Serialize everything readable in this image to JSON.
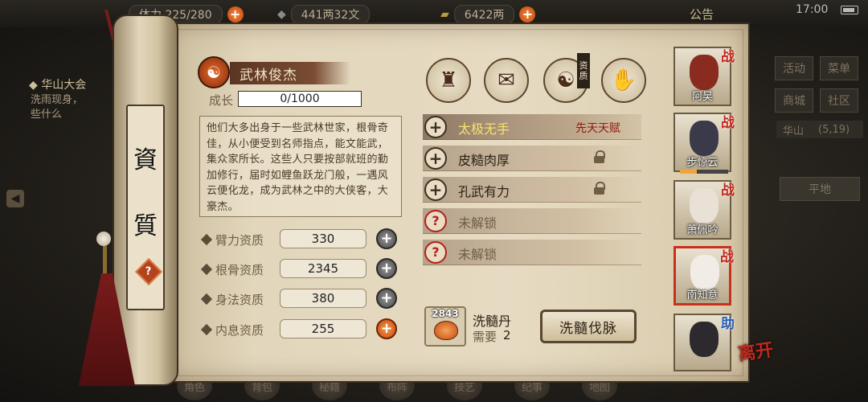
{
  "topbar": {
    "stamina": "体力 225/280",
    "coins": "441两32文",
    "ingots": "6422两",
    "notice": "公告",
    "time": "17:00"
  },
  "background": {
    "left_title": "华山大会",
    "left_desc": "洗雨现身，\n些什么",
    "right_menu": [
      "活动",
      "菜单",
      "商城",
      "社区"
    ],
    "location": "华山",
    "location_coords": "(5,19)",
    "plain_button": "平地",
    "bottom_nav": [
      "角色",
      "背包",
      "秘籍",
      "布阵",
      "技艺",
      "纪事",
      "地图"
    ]
  },
  "scroll": {
    "vertical_title_1": "資",
    "vertical_title_2": "質",
    "help": "?"
  },
  "talent": {
    "name": "武林俊杰",
    "growth_label": "成长",
    "growth_value": "0/1000",
    "description": "他们大多出身于一些武林世家，根骨奇佳，从小便受到名师指点，能文能武，集众家所长。这些人只要按部就班的勤加修行，届时如鲤鱼跃龙门般，一遇风云便化龙，成为武林之中的大侠客，大豪杰。"
  },
  "attributes": [
    {
      "label": "臂力资质",
      "value": "330",
      "plus": "+",
      "plus_color": "gray"
    },
    {
      "label": "根骨资质",
      "value": "2345",
      "plus": "+",
      "plus_color": "gray"
    },
    {
      "label": "身法资质",
      "value": "380",
      "plus": "+",
      "plus_color": "gray"
    },
    {
      "label": "内息资质",
      "value": "255",
      "plus": "+",
      "plus_color": "orange"
    }
  ],
  "skill_icons": [
    {
      "name": "hat-icon"
    },
    {
      "name": "bundle-icon"
    },
    {
      "name": "taiji-icon",
      "tag": "资质"
    },
    {
      "name": "body-icon"
    }
  ],
  "traits": [
    {
      "name": "太极无手",
      "tag": "先天天赋",
      "state": "active"
    },
    {
      "name": "皮糙肉厚",
      "state": "locked"
    },
    {
      "name": "孔武有力",
      "state": "locked"
    },
    {
      "name": "未解锁",
      "state": "unknown"
    },
    {
      "name": "未解锁",
      "state": "unknown"
    }
  ],
  "item": {
    "count": "2843",
    "name": "洗髓丹",
    "need_label": "需要",
    "need_value": "2"
  },
  "action_button": "洗髓伐脉",
  "portraits": [
    {
      "name": "阿昊",
      "badge": "战",
      "selected": false
    },
    {
      "name": "步惊云",
      "badge": "战",
      "selected": false,
      "progress": 0.35
    },
    {
      "name": "萧佩吟",
      "badge": "战",
      "selected": false
    },
    {
      "name": "南知意",
      "badge": "战",
      "selected": true
    },
    {
      "name": "",
      "badge": "助",
      "selected": false
    }
  ],
  "leave_button": "离开",
  "colors": {
    "accent_red": "#c1281c",
    "paper": "#e2d6bc",
    "gold_text": "#f7e26a"
  }
}
